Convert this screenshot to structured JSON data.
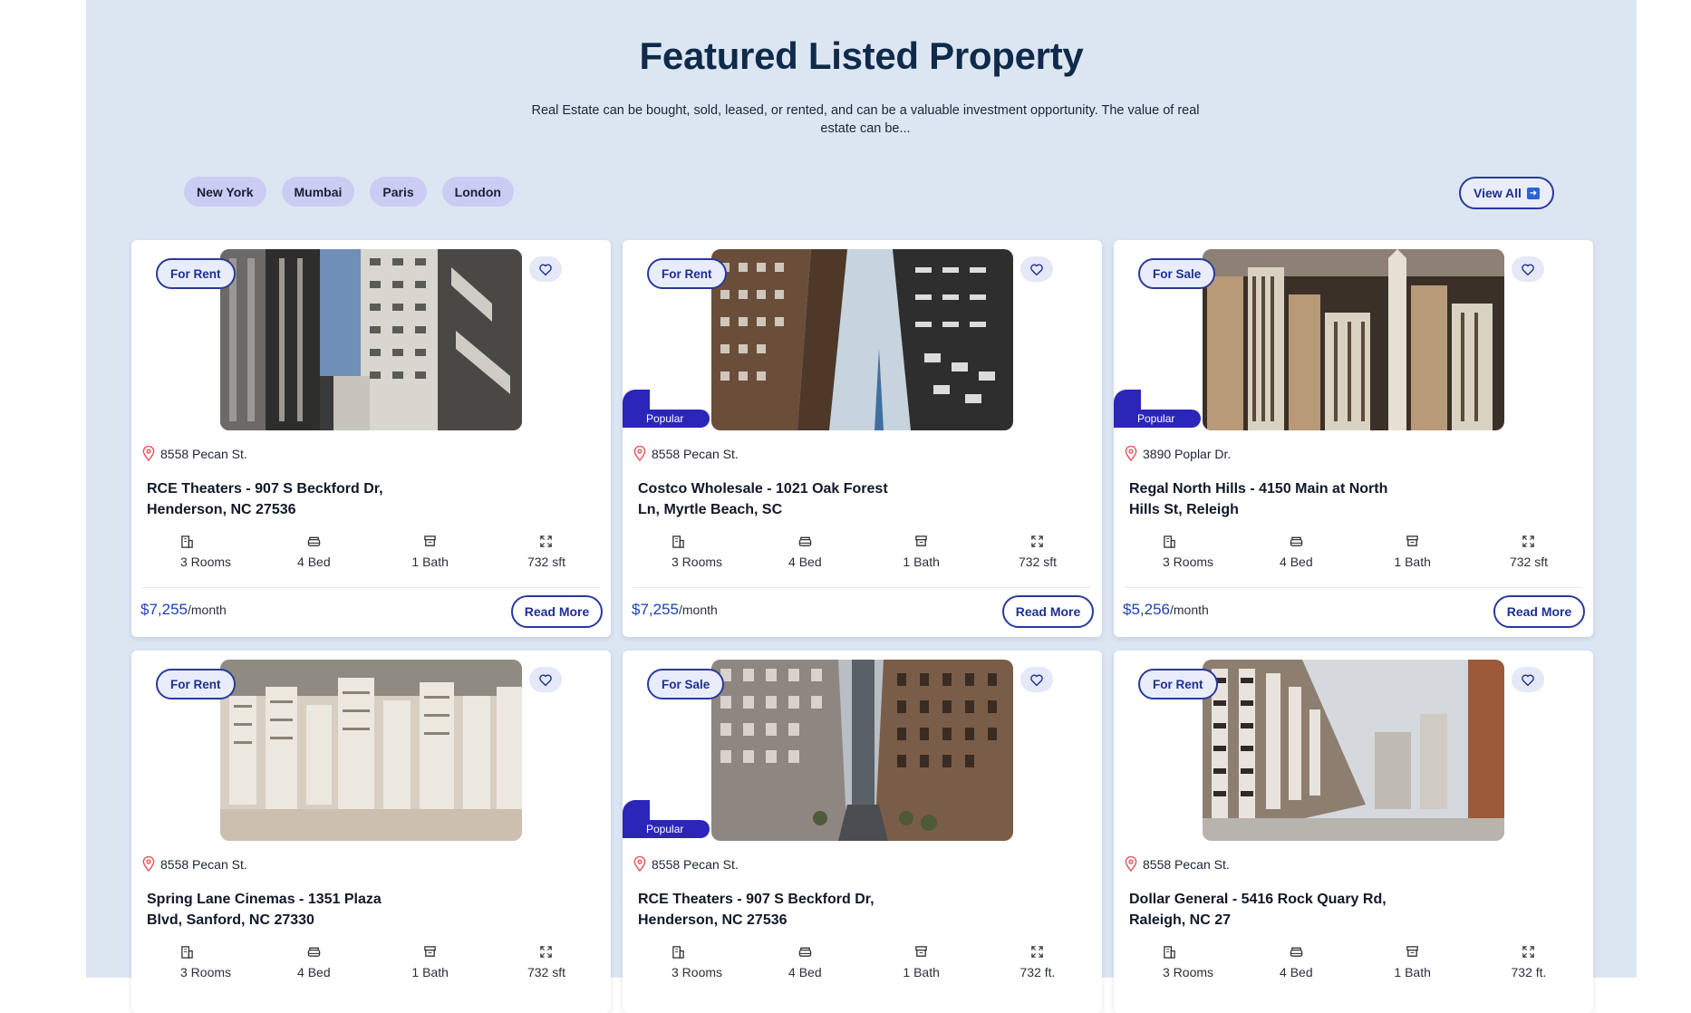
{
  "header": {
    "title": "Featured Listed Property",
    "subtitle": "Real Estate can be bought, sold, leased, or rented, and can be a valuable investment opportunity. The value of real estate can be..."
  },
  "tabs": [
    "New York",
    "Mumbai",
    "Paris",
    "London"
  ],
  "view_all_label": "View All",
  "colors": {
    "background": "#dce6f3",
    "accent": "#2a3a9a",
    "popular": "#2b26b8",
    "price": "#1d3fb3"
  },
  "cards": [
    {
      "badge": "For Rent",
      "popular": "",
      "address": "8558 Pecan St.",
      "name": "RCE Theaters - 907 S Beckford Dr, Henderson, NC 27536",
      "rooms": "3 Rooms",
      "bed": "4 Bed",
      "bath": "1 Bath",
      "area": "732 sft",
      "price": "$7,255",
      "per": "/month",
      "cta": "Read More"
    },
    {
      "badge": "For Rent",
      "popular": "Popular",
      "address": "8558 Pecan St.",
      "name": "Costco Wholesale - 1021 Oak Forest Ln, Myrtle Beach, SC",
      "rooms": "3 Rooms",
      "bed": "4 Bed",
      "bath": "1 Bath",
      "area": "732 sft",
      "price": "$7,255",
      "per": "/month",
      "cta": "Read More"
    },
    {
      "badge": "For Sale",
      "popular": "Popular",
      "address": "3890 Poplar Dr.",
      "name": "Regal North Hills - 4150 Main at North Hills St, Releigh",
      "rooms": "3 Rooms",
      "bed": "4 Bed",
      "bath": "1 Bath",
      "area": "732 sft",
      "price": "$5,256",
      "per": "/month",
      "cta": "Read More"
    },
    {
      "badge": "For Rent",
      "popular": "",
      "address": "8558 Pecan St.",
      "name": "Spring Lane Cinemas - 1351 Plaza Blvd, Sanford, NC 27330",
      "rooms": "3 Rooms",
      "bed": "4 Bed",
      "bath": "1 Bath",
      "area": "732 sft",
      "price": "",
      "per": "",
      "cta": ""
    },
    {
      "badge": "For Sale",
      "popular": "Popular",
      "address": "8558 Pecan St.",
      "name": "RCE Theaters - 907 S Beckford Dr, Henderson, NC 27536",
      "rooms": "3 Rooms",
      "bed": "4 Bed",
      "bath": "1 Bath",
      "area": "732 ft.",
      "price": "",
      "per": "",
      "cta": ""
    },
    {
      "badge": "For Rent",
      "popular": "",
      "address": "8558 Pecan St.",
      "name": "Dollar General - 5416 Rock Quary Rd, Raleigh, NC 27",
      "rooms": "3 Rooms",
      "bed": "4 Bed",
      "bath": "1 Bath",
      "area": "732 ft.",
      "price": "",
      "per": "",
      "cta": ""
    }
  ]
}
